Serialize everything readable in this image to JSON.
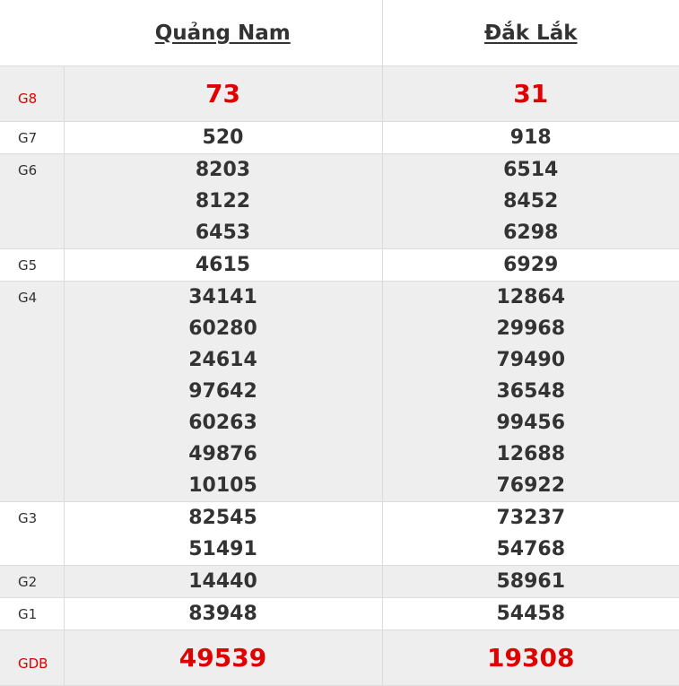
{
  "provinces": [
    "Quảng Nam",
    "Đắk Lắk"
  ],
  "prizes": [
    {
      "label": "G8",
      "values": [
        [
          "73"
        ],
        [
          "31"
        ]
      ]
    },
    {
      "label": "G7",
      "values": [
        [
          "520"
        ],
        [
          "918"
        ]
      ]
    },
    {
      "label": "G6",
      "values": [
        [
          "8203",
          "8122",
          "6453"
        ],
        [
          "6514",
          "8452",
          "6298"
        ]
      ]
    },
    {
      "label": "G5",
      "values": [
        [
          "4615"
        ],
        [
          "6929"
        ]
      ]
    },
    {
      "label": "G4",
      "values": [
        [
          "34141",
          "60280",
          "24614",
          "97642",
          "60263",
          "49876",
          "10105"
        ],
        [
          "12864",
          "29968",
          "79490",
          "36548",
          "99456",
          "12688",
          "76922"
        ]
      ]
    },
    {
      "label": "G3",
      "values": [
        [
          "82545",
          "51491"
        ],
        [
          "73237",
          "54768"
        ]
      ]
    },
    {
      "label": "G2",
      "values": [
        [
          "14440"
        ],
        [
          "58961"
        ]
      ]
    },
    {
      "label": "G1",
      "values": [
        [
          "83948"
        ],
        [
          "54458"
        ]
      ]
    },
    {
      "label": "GDB",
      "values": [
        [
          "49539"
        ],
        [
          "19308"
        ]
      ]
    }
  ],
  "colors": {
    "highlight": "#e00000",
    "text": "#333333",
    "shade": "#eeeeee",
    "border": "#dcdcdc"
  }
}
